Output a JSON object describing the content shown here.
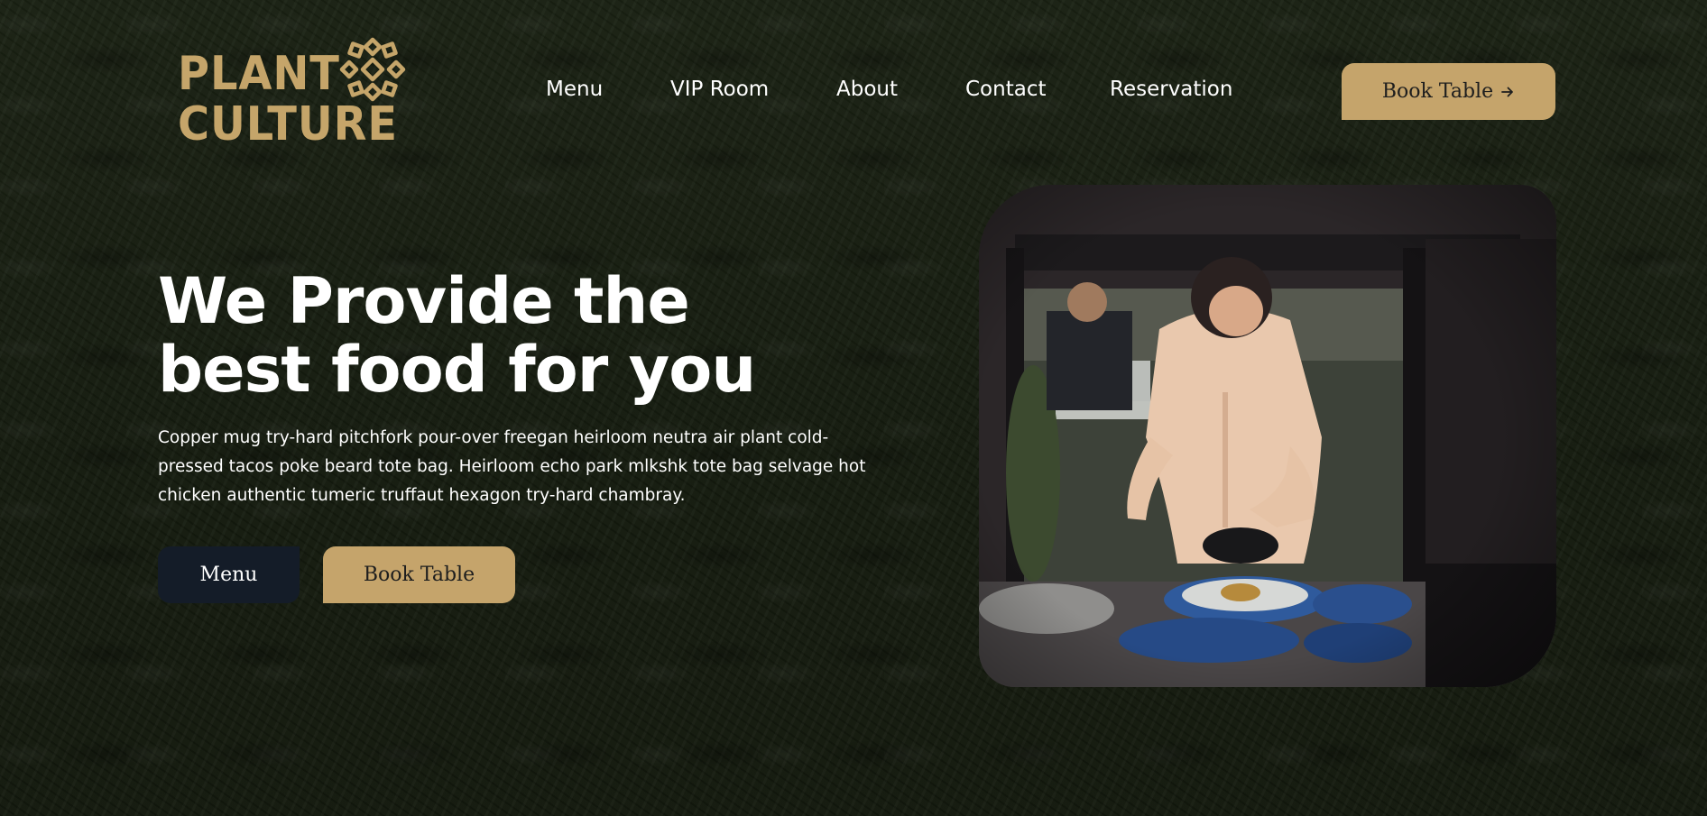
{
  "brand": {
    "line1": "PLANT",
    "line2": "CULTURE",
    "logo_icon": "flower-mandala-icon",
    "color": "#c5a56a"
  },
  "nav": {
    "items": [
      {
        "label": "Menu"
      },
      {
        "label": "VIP Room"
      },
      {
        "label": "About"
      },
      {
        "label": "Contact"
      },
      {
        "label": "Reservation"
      }
    ]
  },
  "header_cta": {
    "label": "Book Table",
    "icon": "arrow-right-icon"
  },
  "hero": {
    "title_line1": "We Provide the",
    "title_line2": "best food for you",
    "body": "Copper mug try-hard pitchfork pour-over freegan heirloom neutra air plant cold-pressed tacos poke beard tote bag. Heirloom echo park mlkshk tote bag selvage hot chicken authentic tumeric truffaut hexagon try-hard chambray.",
    "menu_button": "Menu",
    "book_button": "Book Table",
    "image": "chef-plating-food-in-kitchen-photo"
  },
  "colors": {
    "background": "#18200f",
    "accent_gold": "#c5a46b",
    "dark_button": "#141c28",
    "text": "#ffffff"
  }
}
